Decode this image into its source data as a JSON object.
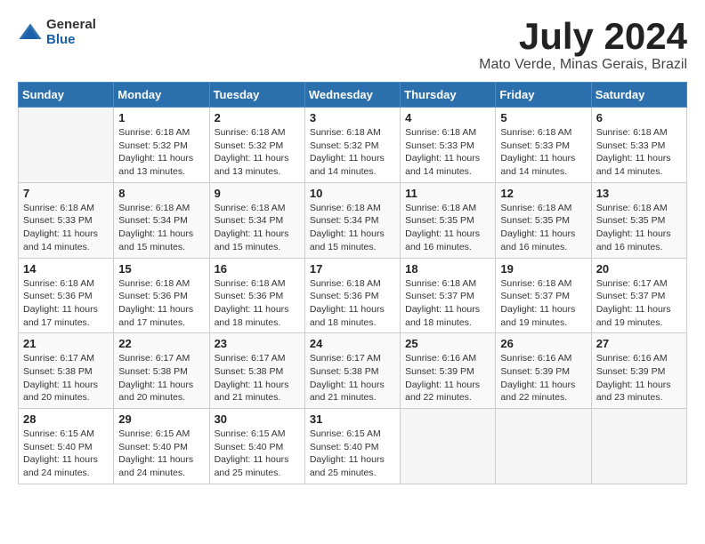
{
  "logo": {
    "general": "General",
    "blue": "Blue"
  },
  "title": "July 2024",
  "location": "Mato Verde, Minas Gerais, Brazil",
  "days_of_week": [
    "Sunday",
    "Monday",
    "Tuesday",
    "Wednesday",
    "Thursday",
    "Friday",
    "Saturday"
  ],
  "weeks": [
    [
      {
        "day": "",
        "info": ""
      },
      {
        "day": "1",
        "info": "Sunrise: 6:18 AM\nSunset: 5:32 PM\nDaylight: 11 hours\nand 13 minutes."
      },
      {
        "day": "2",
        "info": "Sunrise: 6:18 AM\nSunset: 5:32 PM\nDaylight: 11 hours\nand 13 minutes."
      },
      {
        "day": "3",
        "info": "Sunrise: 6:18 AM\nSunset: 5:32 PM\nDaylight: 11 hours\nand 14 minutes."
      },
      {
        "day": "4",
        "info": "Sunrise: 6:18 AM\nSunset: 5:33 PM\nDaylight: 11 hours\nand 14 minutes."
      },
      {
        "day": "5",
        "info": "Sunrise: 6:18 AM\nSunset: 5:33 PM\nDaylight: 11 hours\nand 14 minutes."
      },
      {
        "day": "6",
        "info": "Sunrise: 6:18 AM\nSunset: 5:33 PM\nDaylight: 11 hours\nand 14 minutes."
      }
    ],
    [
      {
        "day": "7",
        "info": "Sunrise: 6:18 AM\nSunset: 5:33 PM\nDaylight: 11 hours\nand 14 minutes."
      },
      {
        "day": "8",
        "info": "Sunrise: 6:18 AM\nSunset: 5:34 PM\nDaylight: 11 hours\nand 15 minutes."
      },
      {
        "day": "9",
        "info": "Sunrise: 6:18 AM\nSunset: 5:34 PM\nDaylight: 11 hours\nand 15 minutes."
      },
      {
        "day": "10",
        "info": "Sunrise: 6:18 AM\nSunset: 5:34 PM\nDaylight: 11 hours\nand 15 minutes."
      },
      {
        "day": "11",
        "info": "Sunrise: 6:18 AM\nSunset: 5:35 PM\nDaylight: 11 hours\nand 16 minutes."
      },
      {
        "day": "12",
        "info": "Sunrise: 6:18 AM\nSunset: 5:35 PM\nDaylight: 11 hours\nand 16 minutes."
      },
      {
        "day": "13",
        "info": "Sunrise: 6:18 AM\nSunset: 5:35 PM\nDaylight: 11 hours\nand 16 minutes."
      }
    ],
    [
      {
        "day": "14",
        "info": "Sunrise: 6:18 AM\nSunset: 5:36 PM\nDaylight: 11 hours\nand 17 minutes."
      },
      {
        "day": "15",
        "info": "Sunrise: 6:18 AM\nSunset: 5:36 PM\nDaylight: 11 hours\nand 17 minutes."
      },
      {
        "day": "16",
        "info": "Sunrise: 6:18 AM\nSunset: 5:36 PM\nDaylight: 11 hours\nand 18 minutes."
      },
      {
        "day": "17",
        "info": "Sunrise: 6:18 AM\nSunset: 5:36 PM\nDaylight: 11 hours\nand 18 minutes."
      },
      {
        "day": "18",
        "info": "Sunrise: 6:18 AM\nSunset: 5:37 PM\nDaylight: 11 hours\nand 18 minutes."
      },
      {
        "day": "19",
        "info": "Sunrise: 6:18 AM\nSunset: 5:37 PM\nDaylight: 11 hours\nand 19 minutes."
      },
      {
        "day": "20",
        "info": "Sunrise: 6:17 AM\nSunset: 5:37 PM\nDaylight: 11 hours\nand 19 minutes."
      }
    ],
    [
      {
        "day": "21",
        "info": "Sunrise: 6:17 AM\nSunset: 5:38 PM\nDaylight: 11 hours\nand 20 minutes."
      },
      {
        "day": "22",
        "info": "Sunrise: 6:17 AM\nSunset: 5:38 PM\nDaylight: 11 hours\nand 20 minutes."
      },
      {
        "day": "23",
        "info": "Sunrise: 6:17 AM\nSunset: 5:38 PM\nDaylight: 11 hours\nand 21 minutes."
      },
      {
        "day": "24",
        "info": "Sunrise: 6:17 AM\nSunset: 5:38 PM\nDaylight: 11 hours\nand 21 minutes."
      },
      {
        "day": "25",
        "info": "Sunrise: 6:16 AM\nSunset: 5:39 PM\nDaylight: 11 hours\nand 22 minutes."
      },
      {
        "day": "26",
        "info": "Sunrise: 6:16 AM\nSunset: 5:39 PM\nDaylight: 11 hours\nand 22 minutes."
      },
      {
        "day": "27",
        "info": "Sunrise: 6:16 AM\nSunset: 5:39 PM\nDaylight: 11 hours\nand 23 minutes."
      }
    ],
    [
      {
        "day": "28",
        "info": "Sunrise: 6:15 AM\nSunset: 5:40 PM\nDaylight: 11 hours\nand 24 minutes."
      },
      {
        "day": "29",
        "info": "Sunrise: 6:15 AM\nSunset: 5:40 PM\nDaylight: 11 hours\nand 24 minutes."
      },
      {
        "day": "30",
        "info": "Sunrise: 6:15 AM\nSunset: 5:40 PM\nDaylight: 11 hours\nand 25 minutes."
      },
      {
        "day": "31",
        "info": "Sunrise: 6:15 AM\nSunset: 5:40 PM\nDaylight: 11 hours\nand 25 minutes."
      },
      {
        "day": "",
        "info": ""
      },
      {
        "day": "",
        "info": ""
      },
      {
        "day": "",
        "info": ""
      }
    ]
  ]
}
